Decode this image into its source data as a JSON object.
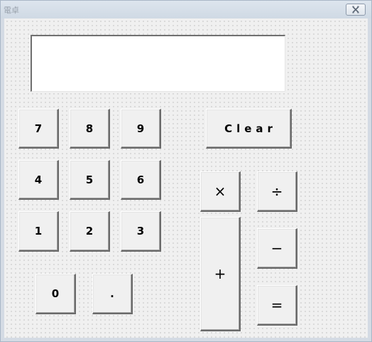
{
  "window": {
    "title": "電卓"
  },
  "display": {
    "value": ""
  },
  "keys": {
    "seven": "7",
    "eight": "8",
    "nine": "9",
    "four": "4",
    "five": "5",
    "six": "6",
    "one": "1",
    "two": "2",
    "three": "3",
    "zero": "0",
    "dot": ".",
    "clear": "Clear",
    "multiply": "×",
    "divide": "÷",
    "plus": "+",
    "minus": "−",
    "equals": "="
  },
  "icons": {
    "close": "close-icon"
  }
}
